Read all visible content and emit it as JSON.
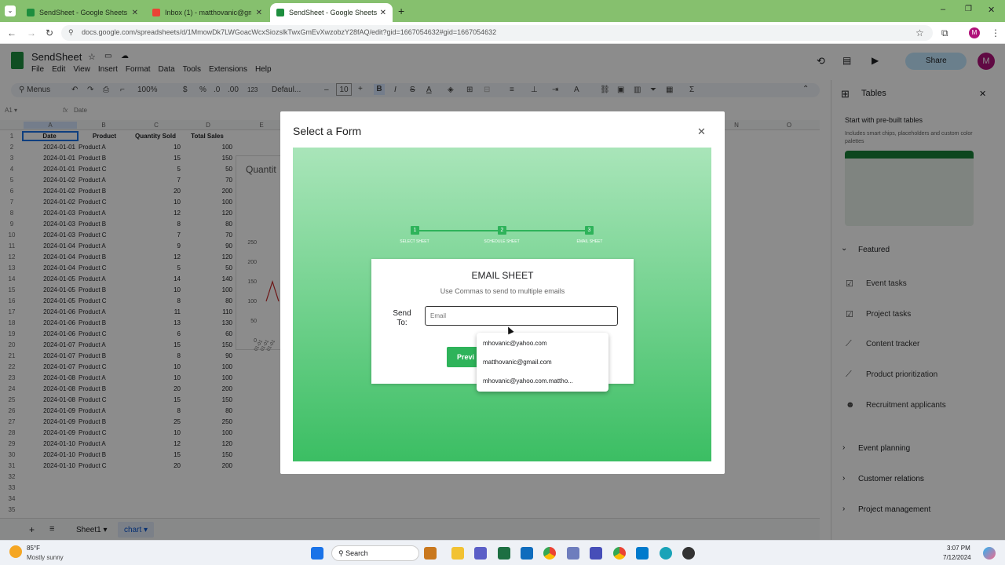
{
  "browser": {
    "tabs": [
      {
        "label": "SendSheet - Google Sheets"
      },
      {
        "label": "Inbox (1) - matthovanic@gmail"
      },
      {
        "label": "SendSheet - Google Sheets"
      }
    ],
    "url": "docs.google.com/spreadsheets/d/1MmowDk7LWGoacWcxSiozslkTwxGmEvXwzobzY28fAQ/edit?gid=1667054632#gid=1667054632"
  },
  "sheets": {
    "doc_title": "SendSheet",
    "menu": [
      "File",
      "Edit",
      "View",
      "Insert",
      "Format",
      "Data",
      "Tools",
      "Extensions",
      "Help"
    ],
    "toolbar": {
      "menus_label": "Menus",
      "zoom": "100%",
      "font": "Defaul...",
      "font_size": "10",
      "currency": "$",
      "percent": "%",
      "decimals": ".0",
      "decimals2": ".00",
      "number_format": "123"
    },
    "share_label": "Share",
    "cell_ref": "A1",
    "formula": "Date",
    "columns": [
      "A",
      "B",
      "C",
      "D",
      "E",
      "N",
      "O"
    ],
    "headers": [
      "Date",
      "Product",
      "Quantity Sold",
      "Total Sales"
    ],
    "rows": [
      [
        "2024-01-01",
        "Product A",
        "10",
        "100"
      ],
      [
        "2024-01-01",
        "Product B",
        "15",
        "150"
      ],
      [
        "2024-01-01",
        "Product C",
        "5",
        "50"
      ],
      [
        "2024-01-02",
        "Product A",
        "7",
        "70"
      ],
      [
        "2024-01-02",
        "Product B",
        "20",
        "200"
      ],
      [
        "2024-01-02",
        "Product C",
        "10",
        "100"
      ],
      [
        "2024-01-03",
        "Product A",
        "12",
        "120"
      ],
      [
        "2024-01-03",
        "Product B",
        "8",
        "80"
      ],
      [
        "2024-01-03",
        "Product C",
        "7",
        "70"
      ],
      [
        "2024-01-04",
        "Product A",
        "9",
        "90"
      ],
      [
        "2024-01-04",
        "Product B",
        "12",
        "120"
      ],
      [
        "2024-01-04",
        "Product C",
        "5",
        "50"
      ],
      [
        "2024-01-05",
        "Product A",
        "14",
        "140"
      ],
      [
        "2024-01-05",
        "Product B",
        "10",
        "100"
      ],
      [
        "2024-01-05",
        "Product C",
        "8",
        "80"
      ],
      [
        "2024-01-06",
        "Product A",
        "11",
        "110"
      ],
      [
        "2024-01-06",
        "Product B",
        "13",
        "130"
      ],
      [
        "2024-01-06",
        "Product C",
        "6",
        "60"
      ],
      [
        "2024-01-07",
        "Product A",
        "15",
        "150"
      ],
      [
        "2024-01-07",
        "Product B",
        "8",
        "90"
      ],
      [
        "2024-01-07",
        "Product C",
        "10",
        "100"
      ],
      [
        "2024-01-08",
        "Product A",
        "10",
        "100"
      ],
      [
        "2024-01-08",
        "Product B",
        "20",
        "200"
      ],
      [
        "2024-01-08",
        "Product C",
        "15",
        "150"
      ],
      [
        "2024-01-09",
        "Product A",
        "8",
        "80"
      ],
      [
        "2024-01-09",
        "Product B",
        "25",
        "250"
      ],
      [
        "2024-01-09",
        "Product C",
        "10",
        "100"
      ],
      [
        "2024-01-10",
        "Product A",
        "12",
        "120"
      ],
      [
        "2024-01-10",
        "Product B",
        "15",
        "150"
      ],
      [
        "2024-01-10",
        "Product C",
        "20",
        "200"
      ]
    ],
    "extra_row_numbers": [
      "32",
      "33",
      "34",
      "35"
    ],
    "chart_fragment": {
      "title": "Quantit",
      "y_ticks": [
        "250",
        "200",
        "150",
        "100",
        "50",
        "0"
      ],
      "x_ticks": [
        "2024-01-01",
        "2024-01-01",
        "2024-01-01"
      ]
    },
    "sheet_tabs": [
      "Sheet1",
      "chart"
    ]
  },
  "side_panel": {
    "title": "Tables",
    "start_heading": "Start with pre-built tables",
    "start_desc": "Includes smart chips, placeholders and custom color palettes",
    "featured": "Featured",
    "featured_items": [
      "Event tasks",
      "Project tasks",
      "Content tracker",
      "Product prioritization",
      "Recruitment applicants"
    ],
    "sections": [
      "Event planning",
      "Customer relations",
      "Project management"
    ]
  },
  "modal": {
    "title": "Select a Form",
    "steps": [
      {
        "num": "1",
        "label": "SELECT SHEET"
      },
      {
        "num": "2",
        "label": "SCHEDULE SHEET"
      },
      {
        "num": "3",
        "label": "EMAIL SHEET"
      }
    ],
    "card_title": "EMAIL SHEET",
    "card_subtitle": "Use Commas to send to multiple emails",
    "send_to_label": "Send To:",
    "email_placeholder": "Email",
    "preview_button": "Previ",
    "autocomplete": [
      "mhovanic@yahoo.com",
      "matthovanic@gmail.com",
      "mhovanic@yahoo.com.mattho..."
    ]
  },
  "taskbar": {
    "temp": "85°F",
    "weather": "Mostly sunny",
    "search": "Search",
    "time": "3:07 PM",
    "date": "7/12/2024"
  }
}
